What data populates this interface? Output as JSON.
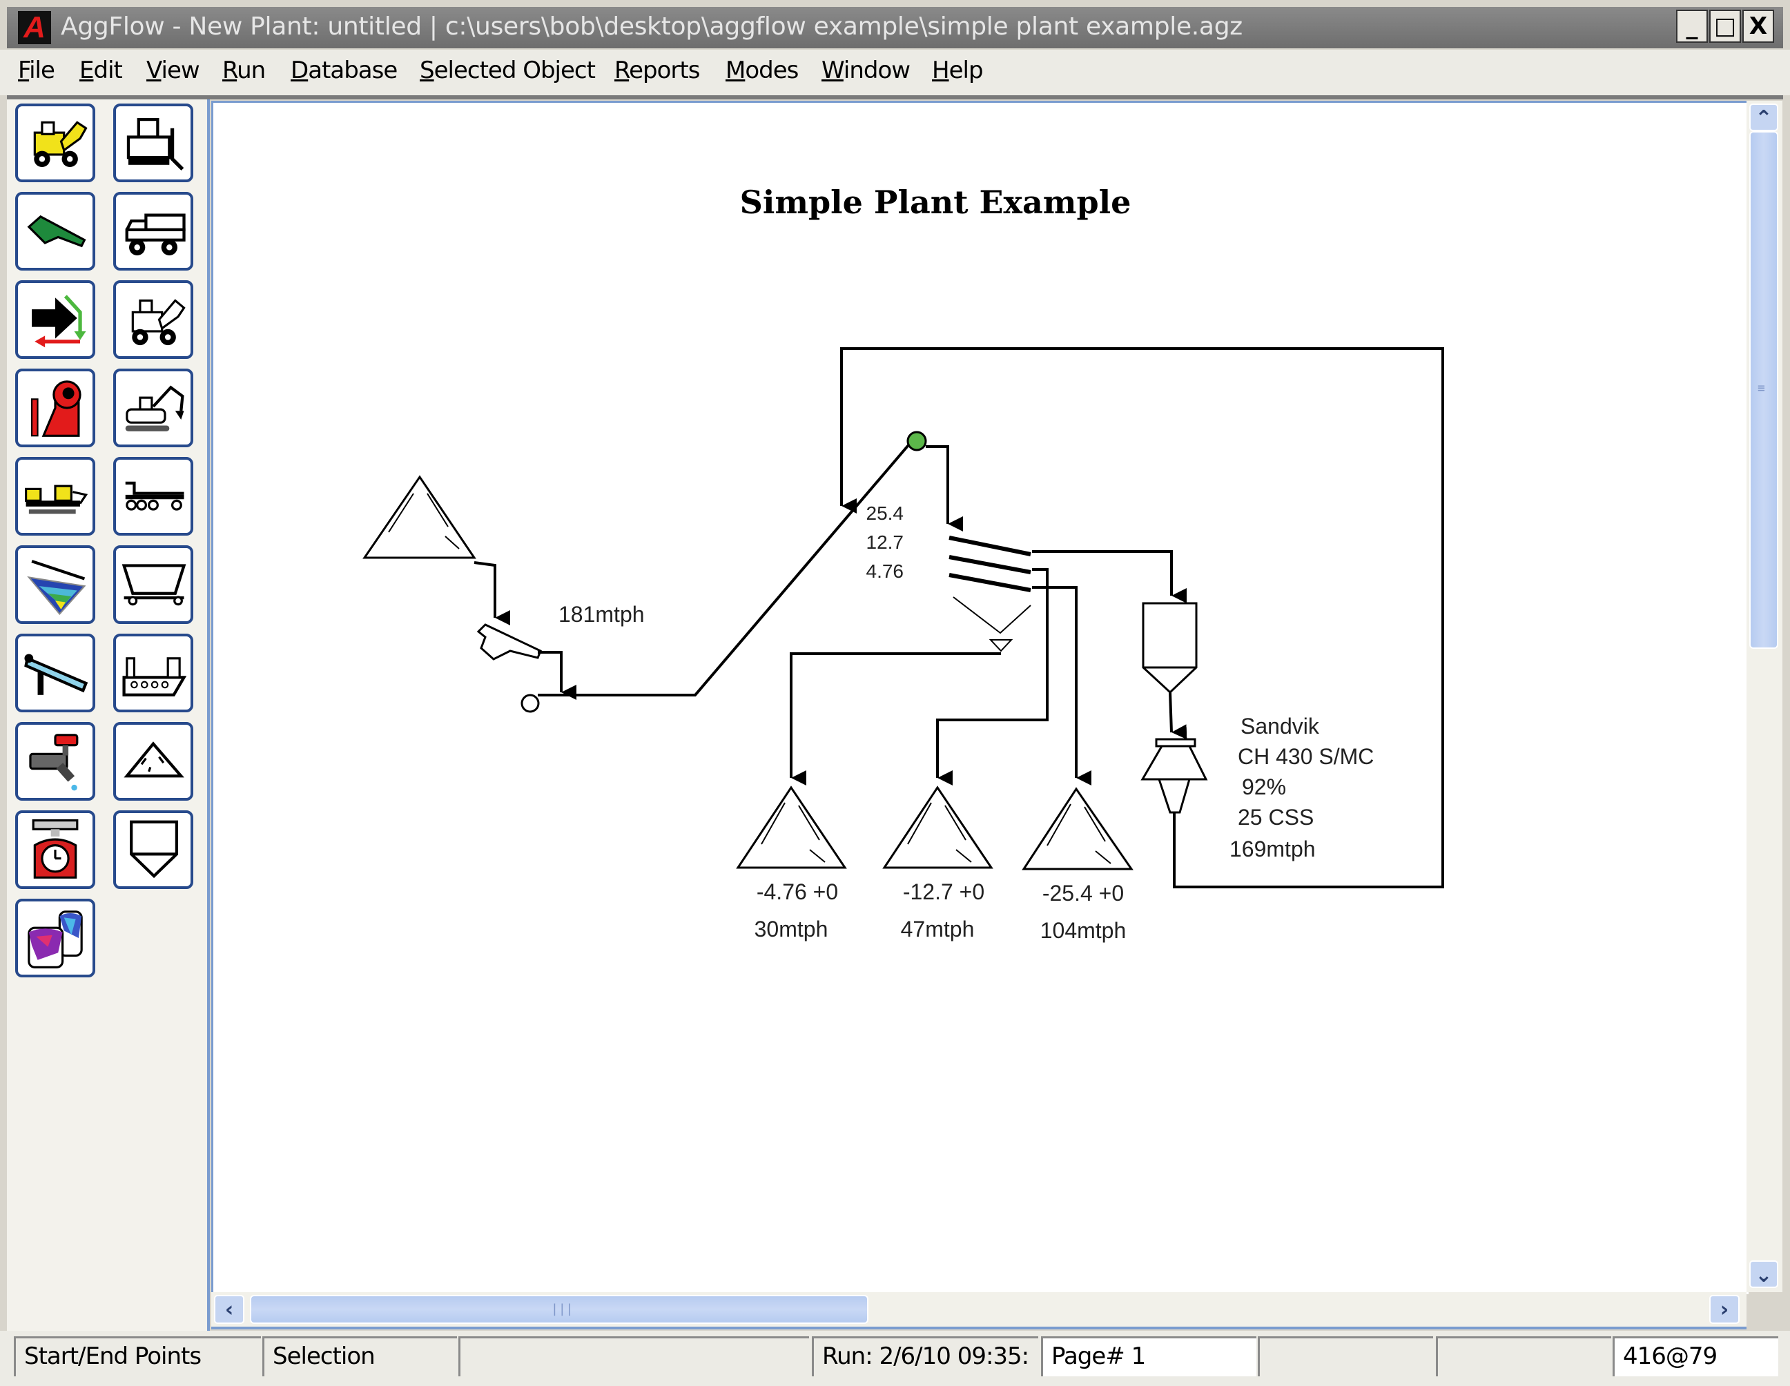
{
  "window": {
    "title": "AggFlow - New Plant: untitled | c:\\users\\bob\\desktop\\aggflow example\\simple plant example.agz",
    "app_icon_letter": "A",
    "controls": {
      "minimize": "_",
      "maximize": "□",
      "close": "X"
    }
  },
  "menu": [
    {
      "label": "File",
      "accel": "F",
      "rest": "ile"
    },
    {
      "label": "Edit",
      "accel": "E",
      "rest": "dit"
    },
    {
      "label": "View",
      "accel": "V",
      "rest": "iew"
    },
    {
      "label": "Run",
      "accel": "R",
      "rest": "un"
    },
    {
      "label": "Database",
      "accel": "D",
      "rest": "atabase"
    },
    {
      "label": "Selected Object",
      "accel": "S",
      "rest": "elected Object"
    },
    {
      "label": "Reports",
      "accel": "R",
      "rest": "eports"
    },
    {
      "label": "Modes",
      "accel": "M",
      "rest": "odes"
    },
    {
      "label": "Window",
      "accel": "W",
      "rest": "indow"
    },
    {
      "label": "Help",
      "accel": "H",
      "rest": "elp"
    }
  ],
  "toolbar": {
    "buttons": [
      {
        "icon": "wheel-loader-icon"
      },
      {
        "icon": "bulldozer-icon"
      },
      {
        "icon": "feeder-icon"
      },
      {
        "icon": "haul-truck-icon"
      },
      {
        "icon": "flow-direction-icon"
      },
      {
        "icon": "loader-outline-icon"
      },
      {
        "icon": "crusher-icon"
      },
      {
        "icon": "excavator-icon"
      },
      {
        "icon": "portable-plant-icon"
      },
      {
        "icon": "trailer-icon"
      },
      {
        "icon": "screen-icon"
      },
      {
        "icon": "rail-car-icon"
      },
      {
        "icon": "conveyor-icon"
      },
      {
        "icon": "barge-icon"
      },
      {
        "icon": "water-valve-icon"
      },
      {
        "icon": "stockpile-icon"
      },
      {
        "icon": "scale-icon"
      },
      {
        "icon": "bin-icon"
      },
      {
        "icon": "paint-blend-icon"
      }
    ]
  },
  "diagram": {
    "title": "Simple Plant Example",
    "feed_rate": "181mtph",
    "screen_decks": [
      "25.4",
      "12.7",
      "4.76"
    ],
    "crusher": {
      "make": "Sandvik",
      "model": "CH 430 S/MC",
      "efficiency": "92%",
      "css": "25 CSS",
      "rate": "169mtph"
    },
    "stockpiles": [
      {
        "size": "-4.76 +0",
        "rate": "30mtph"
      },
      {
        "size": "-12.7 +0",
        "rate": "47mtph"
      },
      {
        "size": "-25.4 +0",
        "rate": "104mtph"
      }
    ],
    "colors": {
      "node_green": "#5cb84a",
      "line": "#000000"
    }
  },
  "statusbar": {
    "mode": "Start/End Points",
    "tool": "Selection",
    "pane3": "",
    "run": "Run: 2/6/10 09:35:",
    "page": "Page# 1",
    "pane6": "",
    "pane7": "",
    "coords": "416@79"
  },
  "scroll": {
    "vertical_position": 0.0,
    "horizontal_position": 0.0
  }
}
